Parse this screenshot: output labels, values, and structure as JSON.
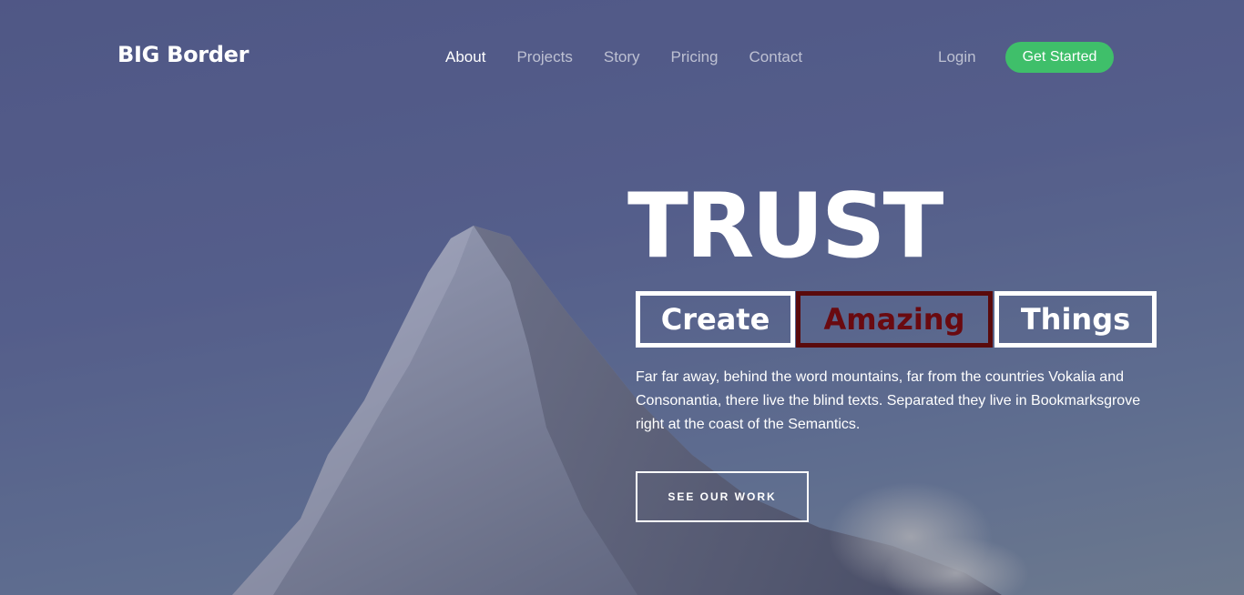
{
  "brand": {
    "name": "BIG Border"
  },
  "nav": {
    "items": [
      {
        "label": "About",
        "active": true
      },
      {
        "label": "Projects",
        "active": false
      },
      {
        "label": "Story",
        "active": false
      },
      {
        "label": "Pricing",
        "active": false
      },
      {
        "label": "Contact",
        "active": false
      }
    ],
    "login_label": "Login",
    "cta_label": "Get Started"
  },
  "hero": {
    "title": "TRUST",
    "words": [
      "Create",
      "Amazing",
      "Things"
    ],
    "description": "Far far away, behind the word mountains, far from the countries Vokalia and Consonantia, there live the blind texts. Separated they live in Bookmarksgrove right at the coast of the Semantics.",
    "button_label": "SEE OUR WORK"
  },
  "colors": {
    "cta_green": "#3fbf6a",
    "highlight_dark_red": "#5a0a0c",
    "overlay_blue": "#535a87"
  }
}
